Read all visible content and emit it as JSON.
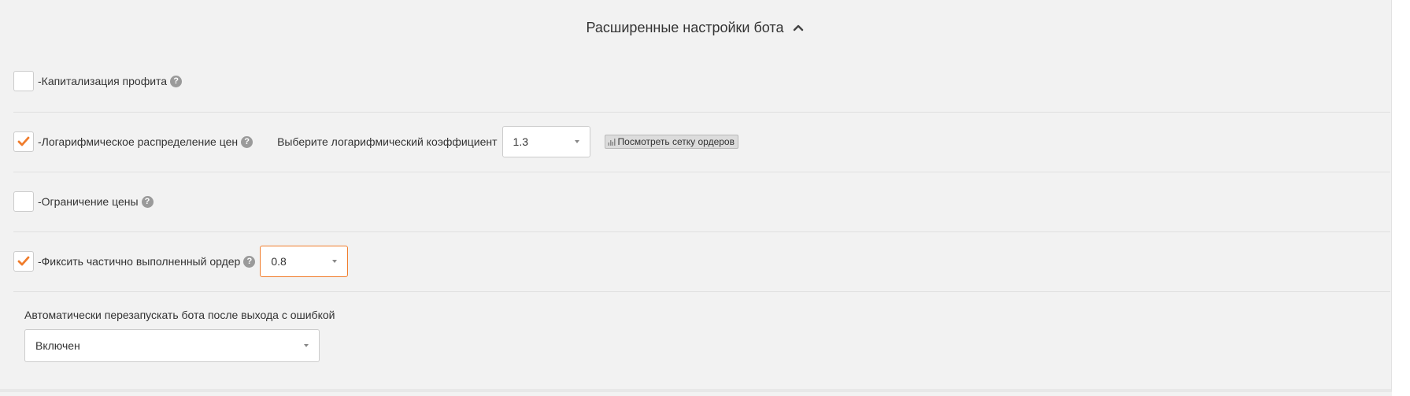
{
  "header": {
    "title": "Расширенные настройки бота",
    "chevron_icon": "chevron-up-icon"
  },
  "options": {
    "profit_capitalization": {
      "label": "-Капитализация профита",
      "checked": false
    },
    "log_distribution": {
      "label": "-Логарифмическое распределение цен",
      "checked": true,
      "coef_label": "Выберите логарифмический коэффициент",
      "coef_value": "1.3",
      "grid_button_label": "Посмотреть сетку ордеров",
      "grid_button_icon": "bar-chart-icon"
    },
    "price_limit": {
      "label": "-Ограничение цены",
      "checked": false
    },
    "partial_fix": {
      "label": "-Фиксить частично выполненный ордер",
      "checked": true,
      "value": "0.8"
    },
    "auto_restart": {
      "label": "Автоматически перезапускать бота после выхода с ошибкой",
      "value": "Включен"
    }
  },
  "help_glyph": "?",
  "colors": {
    "accent": "#f07c2b",
    "background": "#f2f2f2",
    "help_icon": "#9a9a9a"
  }
}
